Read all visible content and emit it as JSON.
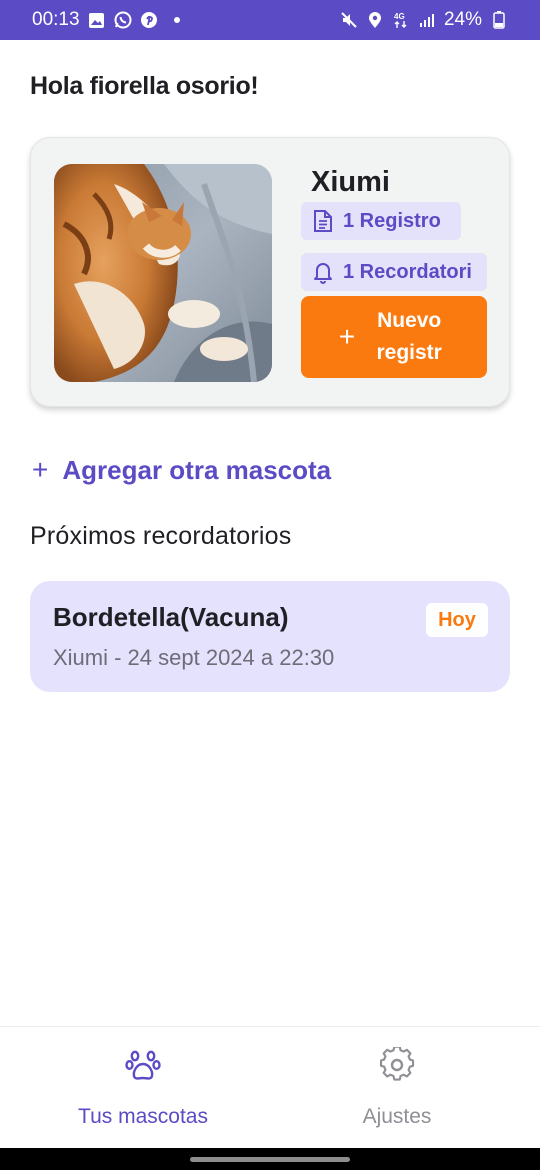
{
  "status_bar": {
    "time": "00:13",
    "battery": "24%",
    "left_icons": [
      "gallery-icon",
      "whatsapp-icon",
      "pinterest-icon",
      "dot-icon"
    ],
    "right_icons": [
      "mute-icon",
      "location-icon",
      "4g-icon",
      "signal-icon",
      "battery-icon"
    ]
  },
  "greeting": "Hola fiorella osorio!",
  "pet_card": {
    "name": "Xiumi",
    "records_label": "1 Registro",
    "reminders_label": "1 Recordatori",
    "new_record_label": "Nuevo registr",
    "photo_alt": "cat-photo"
  },
  "add_pet_label": "Agregar otra mascota",
  "upcoming_title": "Próximos recordatorios",
  "reminders": [
    {
      "title": "Bordetella(Vacuna)",
      "subtitle": "Xiumi - 24 sept 2024 a 22:30",
      "badge": "Hoy"
    }
  ],
  "bottom_nav": {
    "pets_label": "Tus mascotas",
    "settings_label": "Ajustes"
  },
  "colors": {
    "primary": "#5b4bc4",
    "accent": "#fb7a0f",
    "chip_bg": "#e4e1fb",
    "card_bg": "#f2f3f3",
    "reminder_bg": "#e5e2fd"
  }
}
